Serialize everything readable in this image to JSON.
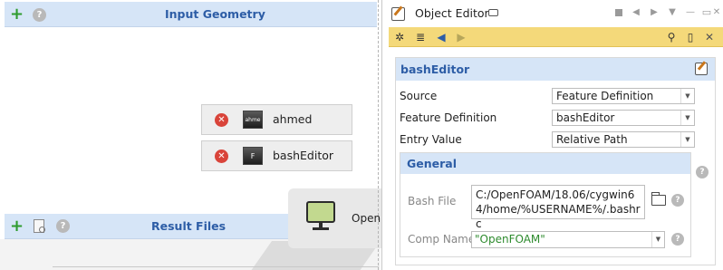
{
  "left_panel": {
    "input_geometry": {
      "title": "Input Geometry"
    },
    "nodes": [
      {
        "label": "ahmed",
        "thumb_text": "ahme"
      },
      {
        "label": "bashEditor",
        "thumb_text": "F"
      }
    ],
    "result_files": {
      "title": "Result Files"
    },
    "preview_card": {
      "name": "OpenF"
    }
  },
  "object_editor": {
    "title": "Object Editor",
    "section": {
      "title": "bashEditor",
      "fields": [
        {
          "label": "Source",
          "value": "Feature Definition"
        },
        {
          "label": "Feature Definition",
          "value": "bashEditor"
        },
        {
          "label": "Entry Value",
          "value": "Relative Path"
        }
      ],
      "general": {
        "title": "General",
        "bash_file_label": "Bash File",
        "bash_file_value": "C:/OpenFOAM/18.06/cygwin64/home/%USERNAME%/.bashrc",
        "comp_name_label": "Comp Name",
        "comp_name_value": "\"OpenFOAM\""
      }
    }
  },
  "colors": {
    "header_bg": "#d6e5f7",
    "header_text": "#2d5da6",
    "toolbar_bg": "#f4d97a",
    "add_green": "#2e9b2e",
    "remove_red": "#d9443a",
    "comp_value_green": "#2e8b2e"
  },
  "icons": [
    "add-icon",
    "help-icon",
    "remove-icon",
    "document-icon",
    "monitor-icon",
    "edit-icon",
    "folder-icon",
    "search-icon",
    "copy-icon",
    "close-icon",
    "back-arrow-icon",
    "forward-arrow-icon",
    "list-icon",
    "wizard-icon"
  ]
}
